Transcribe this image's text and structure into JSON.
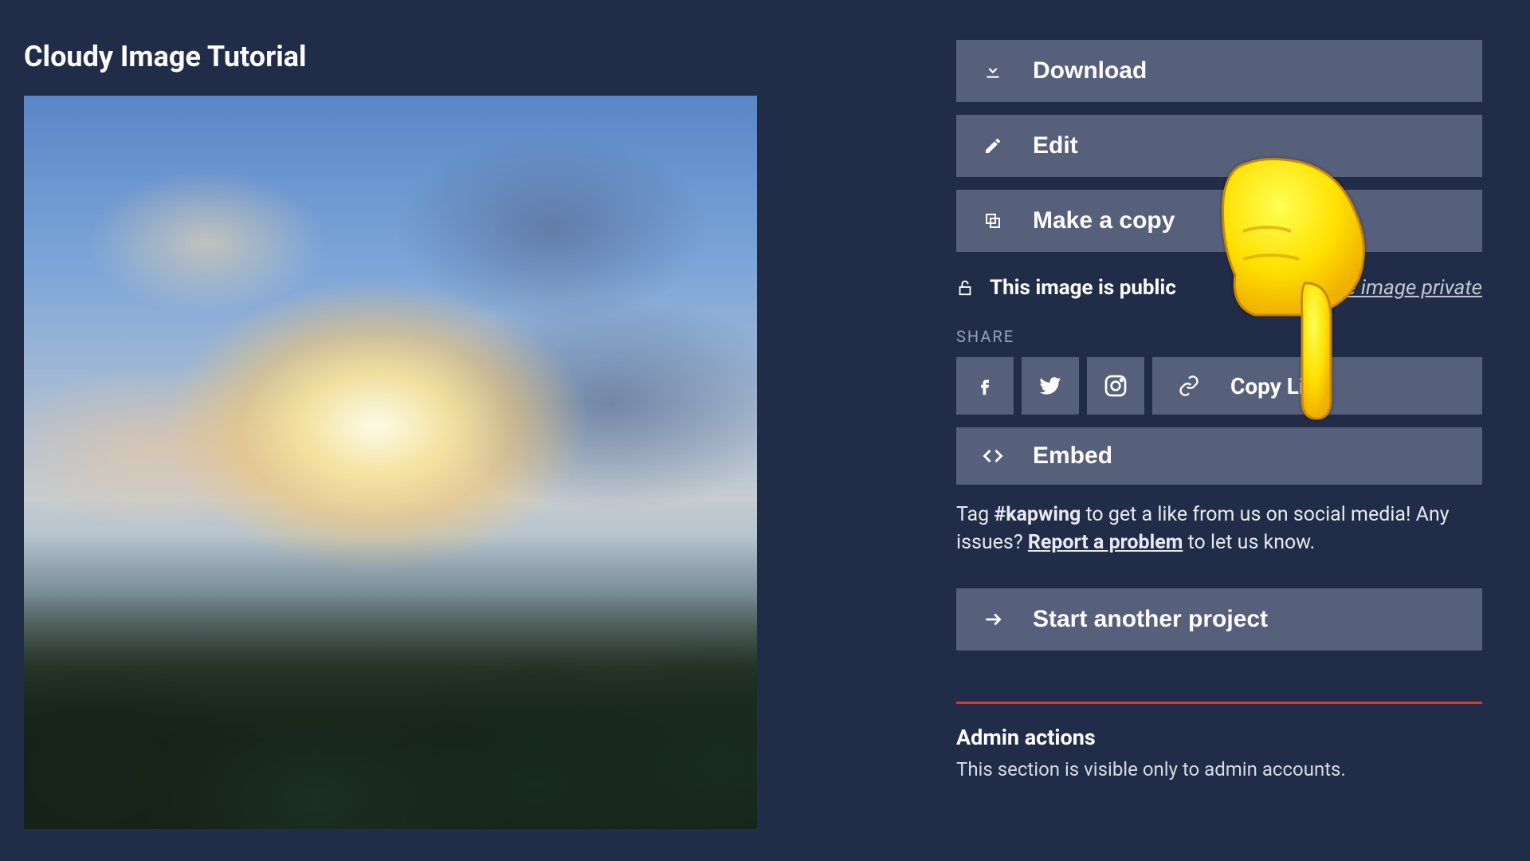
{
  "title": "Cloudy Image Tutorial",
  "actions": {
    "download": "Download",
    "edit": "Edit",
    "make_copy": "Make a copy",
    "start_another": "Start another project"
  },
  "privacy": {
    "status": "This image is public",
    "make_private_link": "Make image private"
  },
  "share": {
    "heading": "SHARE",
    "copy_link": "Copy Link",
    "embed": "Embed",
    "icons": {
      "facebook": "facebook-icon",
      "twitter": "twitter-icon",
      "instagram": "instagram-icon"
    }
  },
  "tag_line": {
    "prefix": "Tag ",
    "hashtag": "#kapwing",
    "mid": " to get a like from us on social media! Any issues? ",
    "report": "Report a problem",
    "suffix": " to let us know."
  },
  "admin": {
    "title": "Admin actions",
    "subtitle": "This section is visible only to admin accounts."
  }
}
